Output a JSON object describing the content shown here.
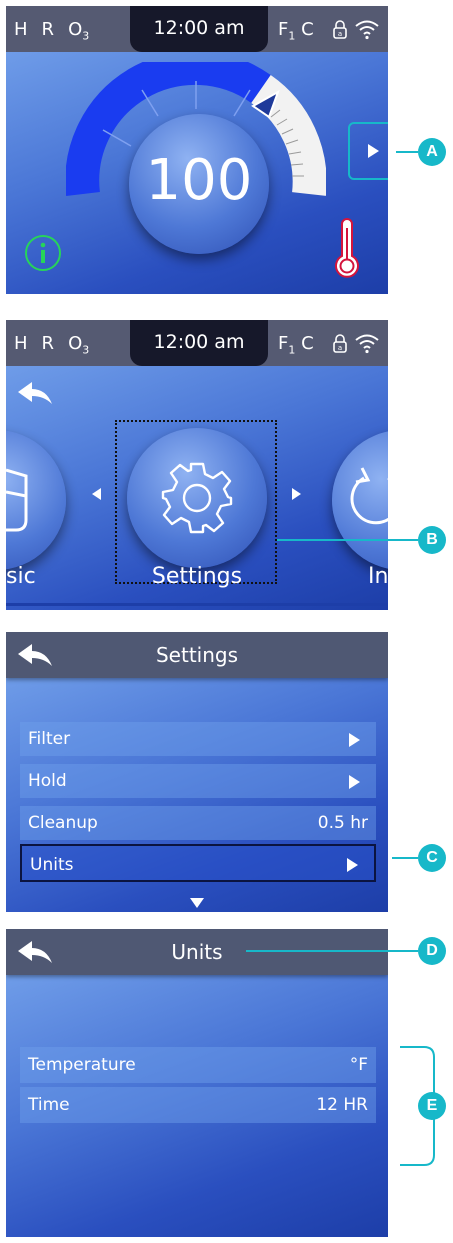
{
  "status": {
    "h": "H",
    "r": "R",
    "o": "O",
    "o_sub": "3",
    "time": "12:00 am",
    "f": "F",
    "f_sub": "1",
    "c": "C"
  },
  "screen1": {
    "set_temperature": "100",
    "info_icon": "info-icon",
    "thermometer_icon": "thermometer-icon",
    "next_icon": "play-icon",
    "gauge_fill_fraction": 0.8
  },
  "screen2": {
    "items": [
      {
        "label": "sic",
        "icon": "music-icon"
      },
      {
        "label": "Settings",
        "icon": "gear-icon"
      },
      {
        "label": "In",
        "icon": "power-icon"
      }
    ]
  },
  "screen3": {
    "title": "Settings",
    "rows": [
      {
        "label": "Filter",
        "value": ""
      },
      {
        "label": "Hold",
        "value": ""
      },
      {
        "label": "Cleanup",
        "value": "0.5 hr"
      },
      {
        "label": "Units",
        "value": ""
      }
    ]
  },
  "screen4": {
    "title": "Units",
    "rows": [
      {
        "label": "Temperature",
        "value": "°F"
      },
      {
        "label": "Time",
        "value": "12 HR"
      }
    ]
  },
  "callouts": {
    "a": "A",
    "b": "B",
    "c": "C",
    "d": "D",
    "e": "E"
  },
  "colors": {
    "callout": "#17b8c9",
    "gauge": "#1a3cf0",
    "statusbar": "#555a72",
    "info": "#27d45a",
    "thermo": "#d4143c"
  }
}
